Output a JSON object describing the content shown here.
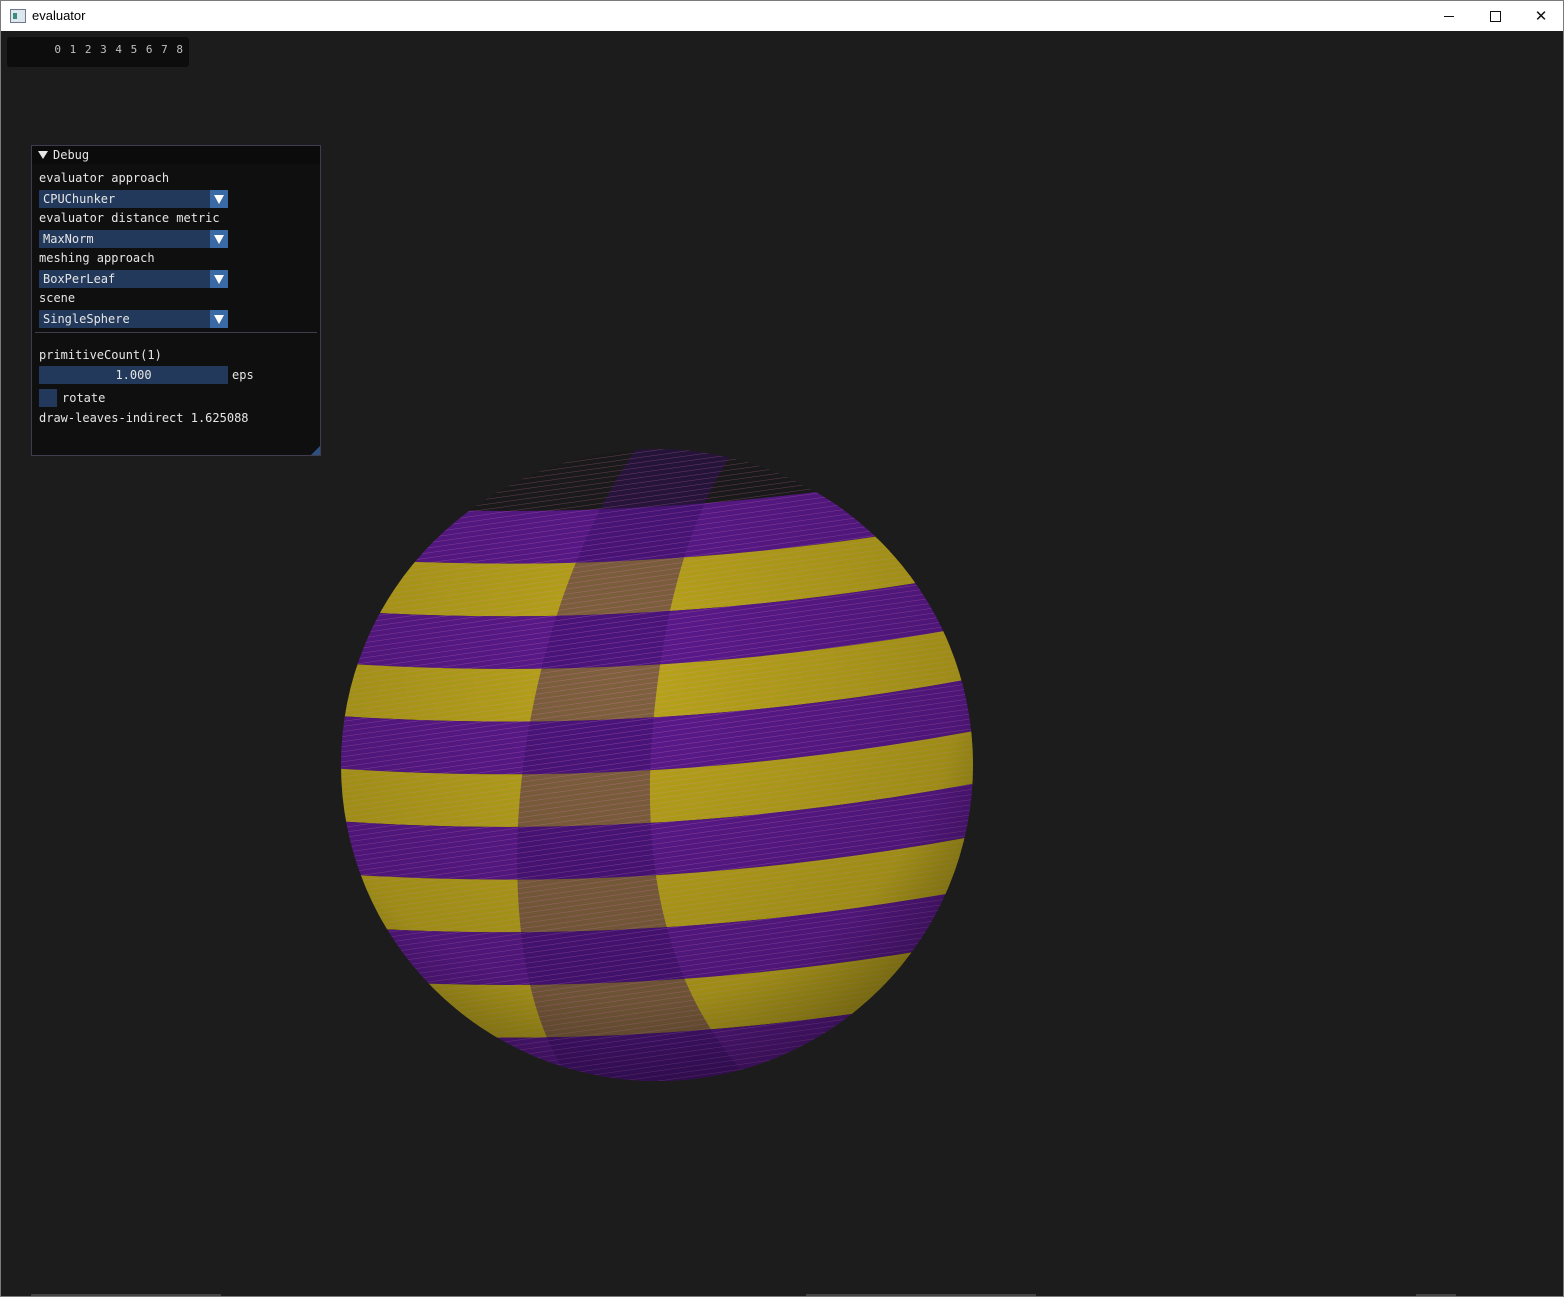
{
  "window": {
    "title": "evaluator",
    "controls": {
      "minimize": "minimize",
      "maximize": "maximize",
      "close": "✕"
    }
  },
  "lod_bar": {
    "digits": "0 1 2 3 4 5 6 7 8"
  },
  "debug_panel": {
    "title": "Debug",
    "evaluator_approach": {
      "label": "evaluator approach",
      "value": "CPUChunker"
    },
    "distance_metric": {
      "label": "evaluator distance metric",
      "value": "MaxNorm"
    },
    "meshing_approach": {
      "label": "meshing approach",
      "value": "BoxPerLeaf"
    },
    "scene": {
      "label": "scene",
      "value": "SingleSphere"
    },
    "primitive_count": "primitiveCount(1)",
    "eps": {
      "value": "1.000",
      "label": "eps"
    },
    "rotate": {
      "label": "rotate",
      "checked": false
    },
    "timing": "draw-leaves-indirect 1.625088"
  },
  "colors": {
    "background": "#1c1c1c",
    "widget": "#23395b",
    "widget_button": "#3a6aa6",
    "stripe_yellow": "#b8a51a",
    "stripe_purple": "#5a1a8c"
  }
}
